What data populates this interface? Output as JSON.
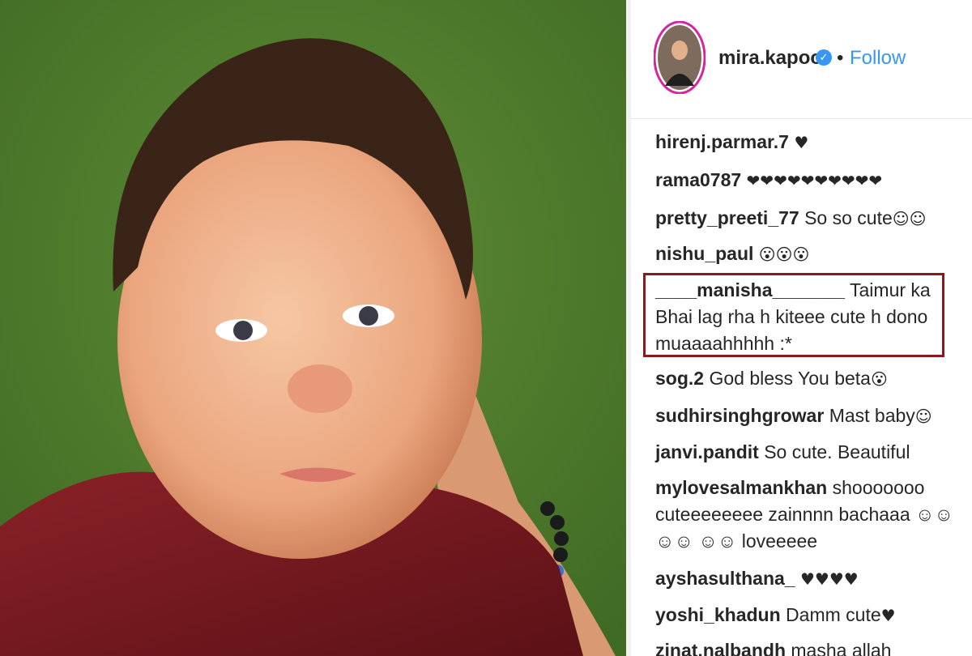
{
  "post": {
    "username": "mira.kapoor",
    "verified_badge": "✓",
    "separator": "•",
    "follow_label": "Follow"
  },
  "comments": [
    {
      "user": "hirenj.parmar.7",
      "text": "",
      "emoji": "♥"
    },
    {
      "user": "rama0787",
      "text": "",
      "emoji": "❤❤❤❤❤❤❤❤❤❤"
    },
    {
      "user": "pretty_preeti_77",
      "text": "So so cute",
      "emoji": "☺☺"
    },
    {
      "user": "nishu_paul",
      "text": "",
      "emoji": "😮😮😮"
    },
    {
      "user": "____manisha_______",
      "text": "Taimur ka Bhai lag rha h kiteee cute h dono muaaaahhhhh :*",
      "emoji": ""
    },
    {
      "user": "sog.2",
      "text": "God bless You beta",
      "emoji": "😮"
    },
    {
      "user": "sudhirsinghgrowar",
      "text": "Mast baby",
      "emoji": "☺"
    },
    {
      "user": "janvi.pandit",
      "text": "So cute. Beautiful",
      "emoji": ""
    },
    {
      "user": "mylovesalmankhan",
      "text": "shooooooo cuteeeeeeee zainnnn bachaaa ☺☺☺☺ ☺☺ loveeeee",
      "emoji": ""
    },
    {
      "user": "ayshasulthana_",
      "text": "",
      "emoji": "♥♥♥♥"
    },
    {
      "user": "yoshi_khadun",
      "text": "Damm cute",
      "emoji": "♥"
    },
    {
      "user": "zinat.nalbandh",
      "text": "masha allah",
      "emoji": ""
    }
  ],
  "colors": {
    "follow": "#3897f0",
    "highlight_border": "#8b1a1a",
    "grass": "#4f7a2e",
    "shirt": "#7a1a1f"
  }
}
